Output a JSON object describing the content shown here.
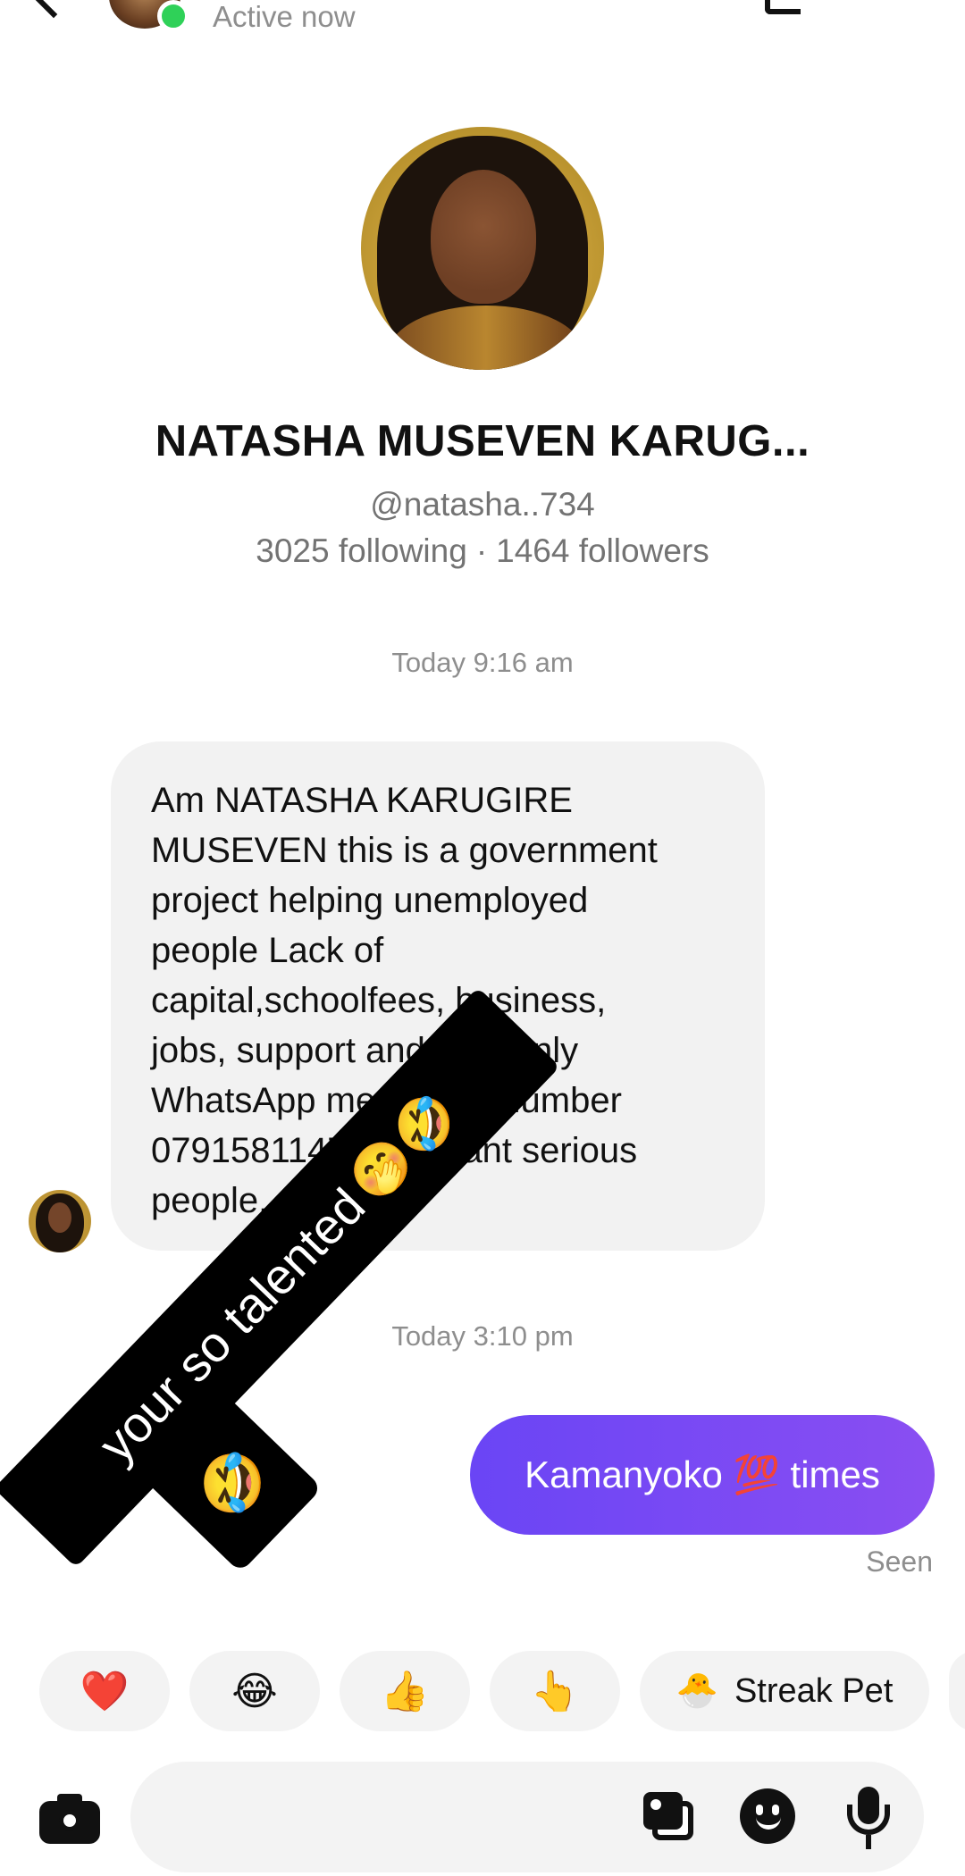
{
  "header": {
    "status": "Active now",
    "back_icon": "back-chevron-icon",
    "online_indicator_color": "#2fd158"
  },
  "profile": {
    "name": "NATASHA MUSEVEN KARUG...",
    "handle": "@natasha..734",
    "following": "3025 following",
    "followers": "1464 followers",
    "separator": "·"
  },
  "conversation": {
    "timestamp_1": "Today 9:16 am",
    "incoming_message": "Am NATASHA KARUGIRE\nMUSEVEN this is a government\nproject helping unemployed\npeople Lack of\ncapital,schoolfees, business,\njobs, support and help only\nWhatsApp me on this number\n0791581147 but I want serious\npeople...",
    "timestamp_2": "Today 3:10 pm",
    "outgoing_message": "Kamanyoko 💯 times",
    "seen": "Seen",
    "outgoing_bubble_colors": [
      "#6a45f5",
      "#8a4ef2"
    ]
  },
  "overlay": {
    "text": "your so talented",
    "emojis_line": "🤭🤣",
    "emoji_extra": "🤣"
  },
  "reactions": {
    "heart": "❤️",
    "laugh": "😂",
    "thumbs_up": "👍",
    "point": "👆",
    "streak_pet_emoji": "🐣",
    "streak_pet_label": "Streak Pet"
  },
  "composer": {
    "placeholder": "",
    "icons": [
      "camera-icon",
      "gallery-icon",
      "sticker-icon",
      "microphone-icon"
    ]
  }
}
